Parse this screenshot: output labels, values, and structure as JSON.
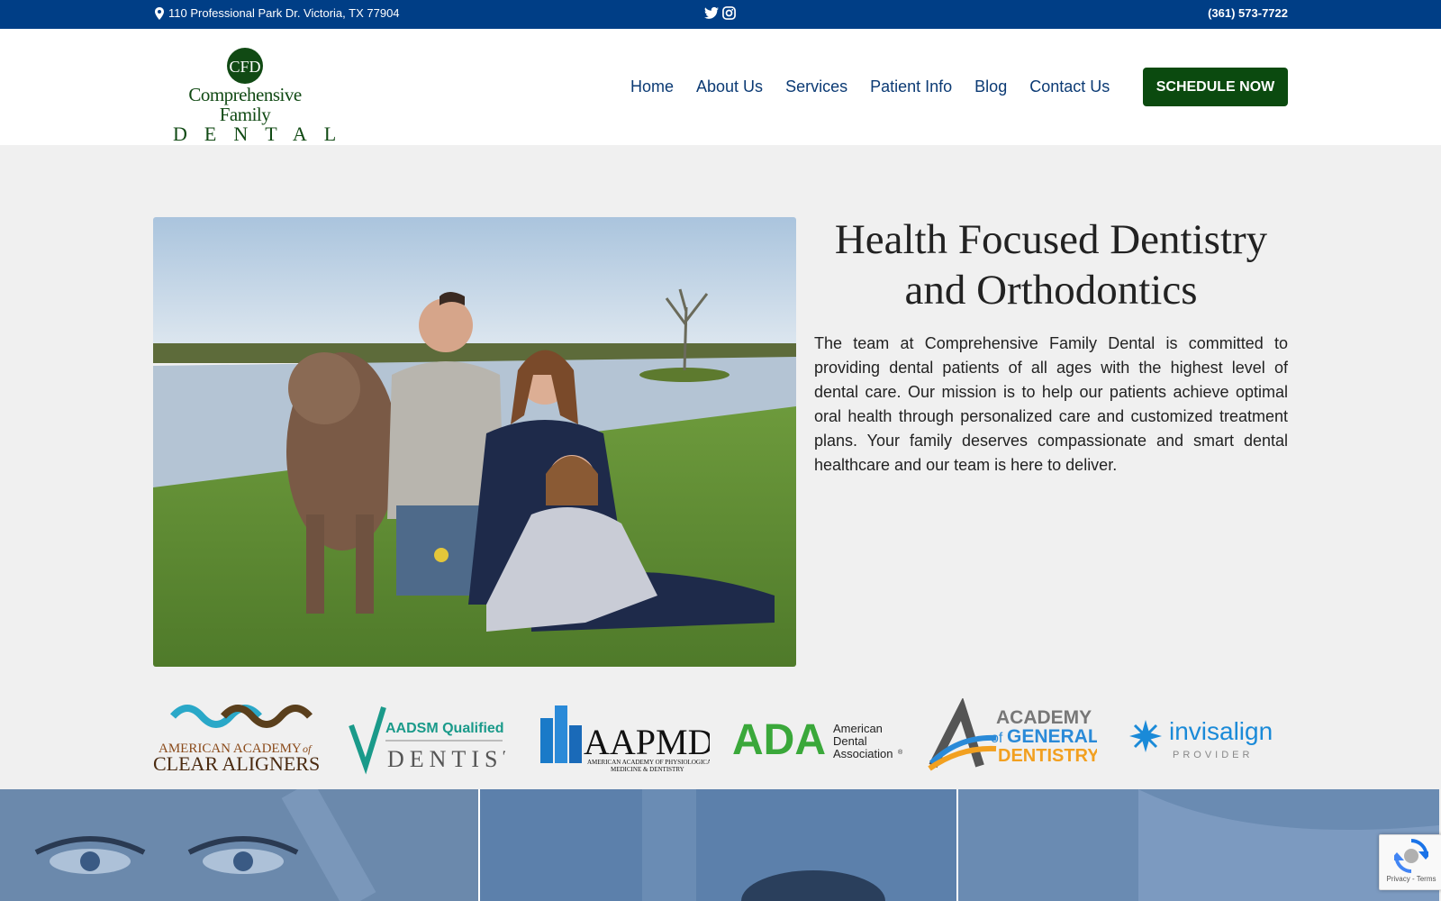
{
  "topbar": {
    "address": "110 Professional Park Dr. Victoria, TX 77904",
    "phone": "(361) 573-7722",
    "social_icons": [
      "twitter-icon",
      "instagram-icon"
    ],
    "bg_color": "#003e86"
  },
  "logo": {
    "line1": "Comprehensive Family",
    "line2": "DENTAL",
    "monogram": "CFD",
    "color": "#114a14"
  },
  "nav": {
    "items": [
      "Home",
      "About Us",
      "Services",
      "Patient Info",
      "Blog",
      "Contact Us"
    ],
    "cta": "SCHEDULE NOW",
    "cta_color": "#0b4a0f",
    "link_color": "#0b3a74"
  },
  "hero": {
    "title": "Health Focused Dentistry and Orthodontics",
    "body": "The team at Comprehensive Family Dental is committed to providing dental patients of all ages with the highest level of dental care. Our mission is to help our patients achieve optimal oral health through personalized care and customized treatment plans. Your family deserves compassionate and smart dental healthcare and our team is here to deliver."
  },
  "affiliations": {
    "aaca": {
      "line1": "AMERICAN ACADEMY",
      "of": "of",
      "line2": "CLEAR ALIGNERS"
    },
    "aadsm": {
      "line1": "AADSM Qualified",
      "line2": "DENTIST"
    },
    "aapmd": {
      "name": "AAPMD",
      "sub1": "AMERICAN ACADEMY OF PHYSIOLOGICAL",
      "sub2": "MEDICINE & DENTISTRY"
    },
    "ada": {
      "name": "ADA",
      "line1": "American",
      "line2": "Dental",
      "line3": "Association",
      "mark": "®"
    },
    "agd": {
      "line1": "ACADEMY",
      "of": "of",
      "line2": "GENERAL",
      "line3": "DENTISTRY"
    },
    "invisalign": {
      "name": "invisalign",
      "sub": "PROVIDER"
    }
  },
  "recaptcha": {
    "links": "Privacy - Terms"
  }
}
